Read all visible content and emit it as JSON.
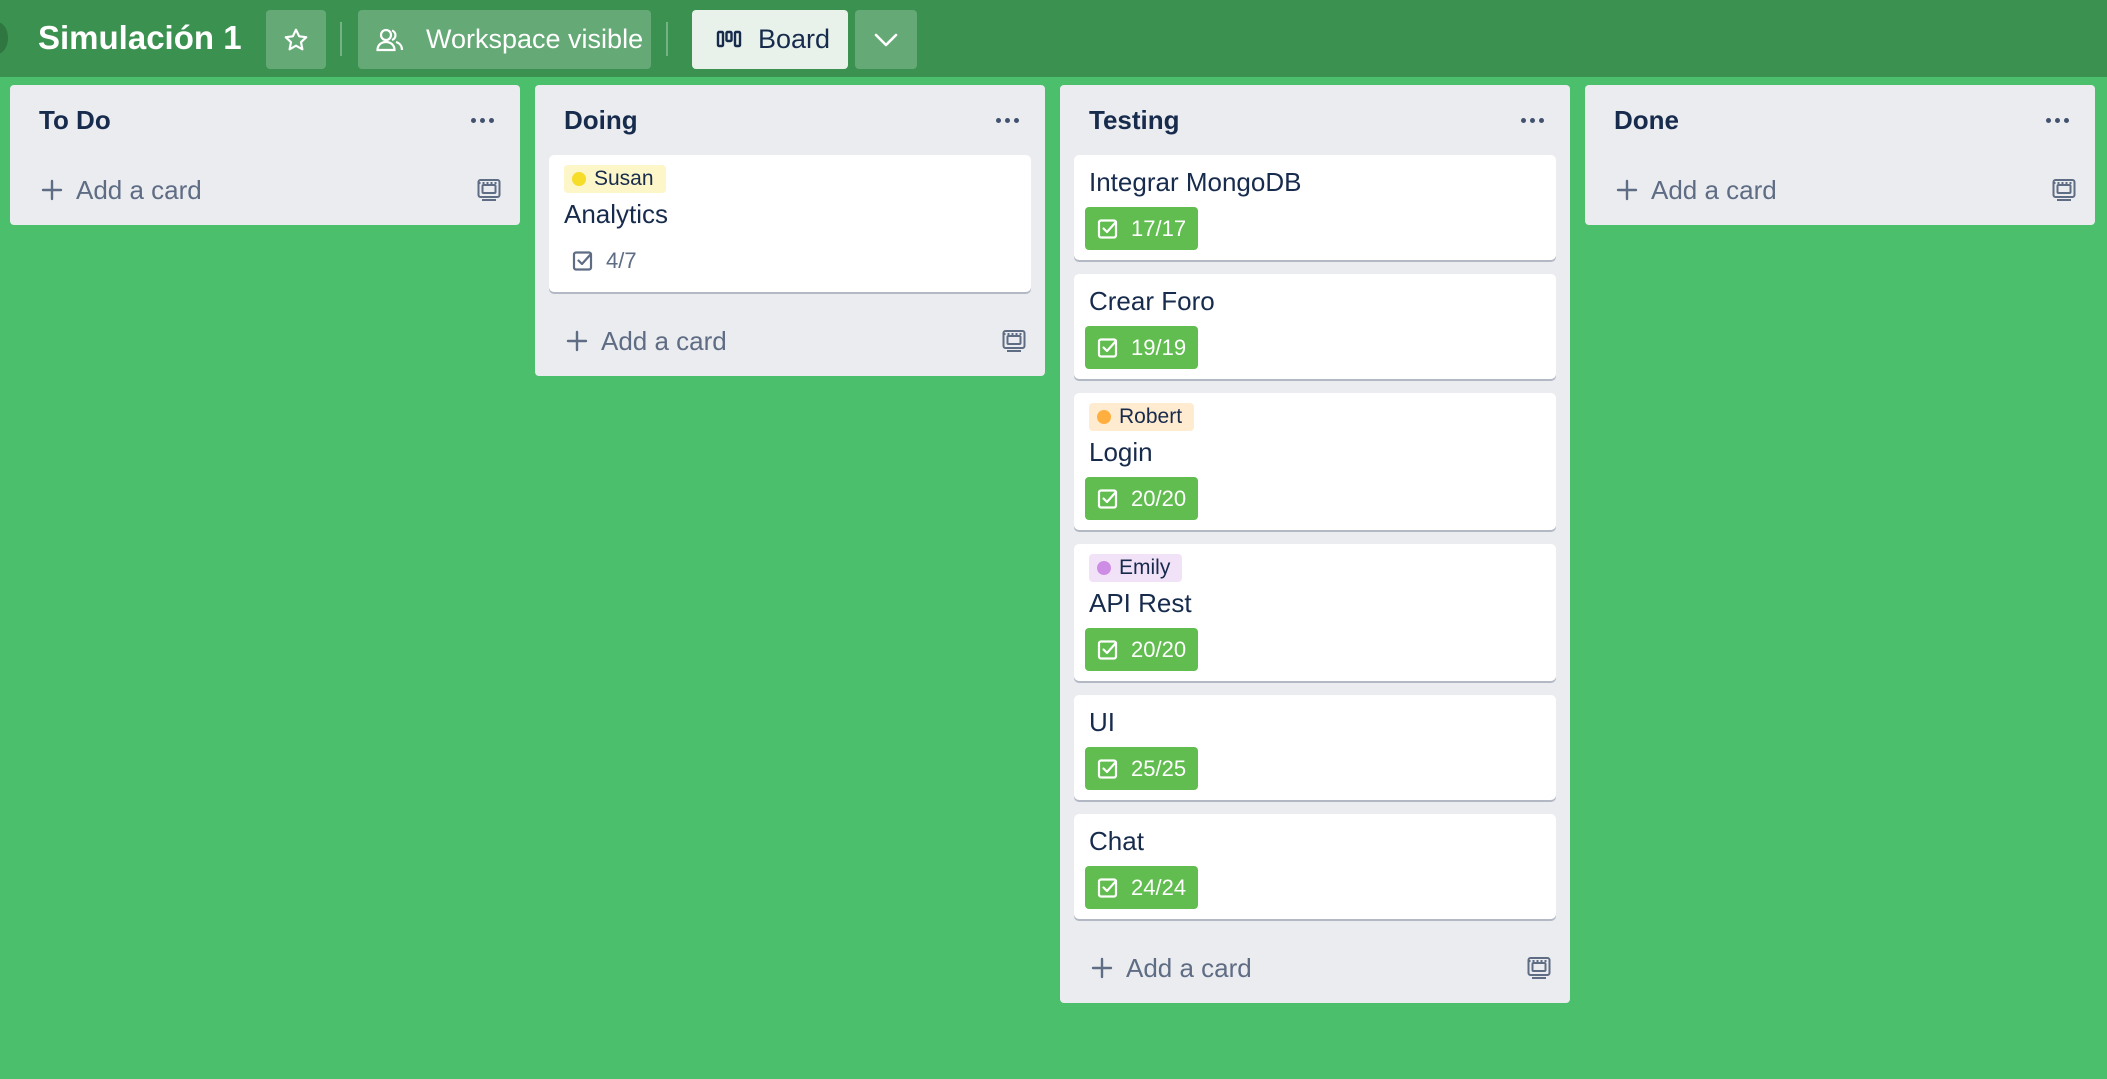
{
  "header": {
    "board_title": "Simulación 1",
    "visibility_label": "Workspace visible",
    "view_label": "Board",
    "bg_color": "#3a9150"
  },
  "board": {
    "bg_color": "#4bbf6b",
    "add_card_label": "Add a card",
    "lists": [
      {
        "title": "To Do",
        "cards": []
      },
      {
        "title": "Doing",
        "cards": [
          {
            "label": "Susan",
            "label_color": "#f5dd29",
            "title": "Analytics",
            "checklist": "4/7",
            "complete": false
          }
        ]
      },
      {
        "title": "Testing",
        "cards": [
          {
            "title": "Integrar MongoDB",
            "checklist": "17/17",
            "complete": true
          },
          {
            "title": "Crear Foro",
            "checklist": "19/19",
            "complete": true
          },
          {
            "label": "Robert",
            "label_color": "#ffaf3f",
            "title": "Login",
            "checklist": "20/20",
            "complete": true
          },
          {
            "label": "Emily",
            "label_color": "#cd8de5",
            "title": "API Rest",
            "checklist": "20/20",
            "complete": true
          },
          {
            "title": "UI",
            "checklist": "25/25",
            "complete": true
          },
          {
            "title": "Chat",
            "checklist": "24/24",
            "complete": true
          }
        ]
      },
      {
        "title": "Done",
        "cards": []
      }
    ]
  }
}
